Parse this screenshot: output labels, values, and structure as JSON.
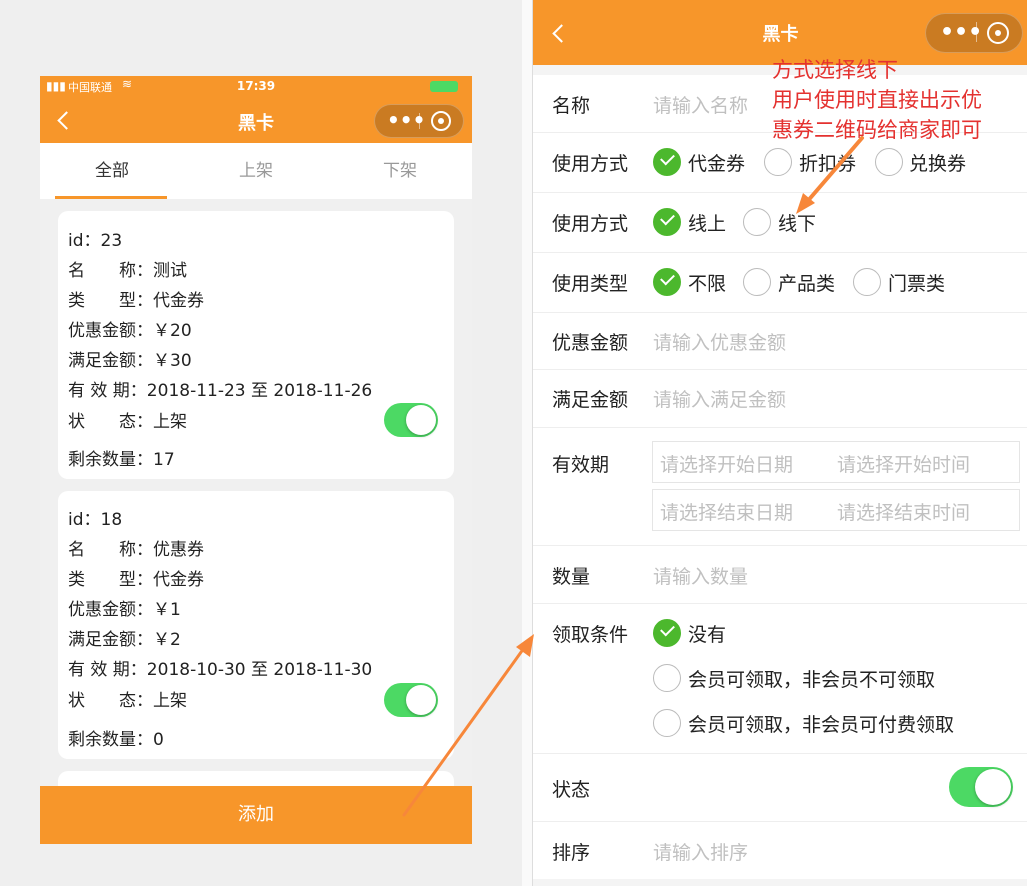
{
  "left": {
    "status": {
      "carrier": "中国联通",
      "time": "17:39"
    },
    "title": "黑卡",
    "tabs": [
      "全部",
      "上架",
      "下架"
    ],
    "cards": [
      {
        "id": "id：23",
        "name": "名　　称：测试",
        "type": "类　　型：代金券",
        "discount": "优惠金额：￥20",
        "threshold": "满足金额：￥30",
        "validity": "有 效 期：2018-11-23 至 2018-11-26",
        "status": "状　　态：上架",
        "status_on": true,
        "remaining": "剩余数量：17"
      },
      {
        "id": "id：18",
        "name": "名　　称：优惠券",
        "type": "类　　型：代金券",
        "discount": "优惠金额：￥1",
        "threshold": "满足金额：￥2",
        "validity": "有 效 期：2018-10-30 至 2018-11-30",
        "status": "状　　态：上架",
        "status_on": true,
        "remaining": "剩余数量：0"
      }
    ],
    "add_button": "添加"
  },
  "right": {
    "title": "黑卡",
    "fields": {
      "name": {
        "label": "名称",
        "placeholder": "请输入名称"
      },
      "use_mode": {
        "label": "使用方式",
        "options": [
          "代金券",
          "折扣券",
          "兑换券"
        ],
        "selected": "代金券"
      },
      "use_channel": {
        "label": "使用方式",
        "options": [
          "线上",
          "线下"
        ],
        "selected": "线上"
      },
      "use_type": {
        "label": "使用类型",
        "options": [
          "不限",
          "产品类",
          "门票类"
        ],
        "selected": "不限"
      },
      "discount": {
        "label": "优惠金额",
        "placeholder": "请输入优惠金额"
      },
      "threshold": {
        "label": "满足金额",
        "placeholder": "请输入满足金额"
      },
      "validity": {
        "label": "有效期",
        "start_date": "请选择开始日期",
        "start_time": "请选择开始时间",
        "end_date": "请选择结束日期",
        "end_time": "请选择结束时间"
      },
      "quantity": {
        "label": "数量",
        "placeholder": "请输入数量"
      },
      "condition": {
        "label": "领取条件",
        "options": [
          "没有",
          "会员可领取，非会员不可领取",
          "会员可领取，非会员可付费领取"
        ],
        "selected": "没有"
      },
      "status": {
        "label": "状态",
        "on": true
      },
      "sort": {
        "label": "排序",
        "placeholder": "请输入排序"
      }
    },
    "annotation": [
      "方式选择线下",
      "用户使用时直接出示优",
      "惠券二维码给商家即可"
    ]
  },
  "colors": {
    "brand": "#f7962a",
    "toggle_on": "#4cd964",
    "radio_on": "#4cb82d",
    "annotation": "#e4312f",
    "arrow": "#f7873a"
  },
  "icons": [
    "back-icon",
    "more-dots-icon",
    "close-target-icon",
    "wifi-icon",
    "battery-icon"
  ]
}
